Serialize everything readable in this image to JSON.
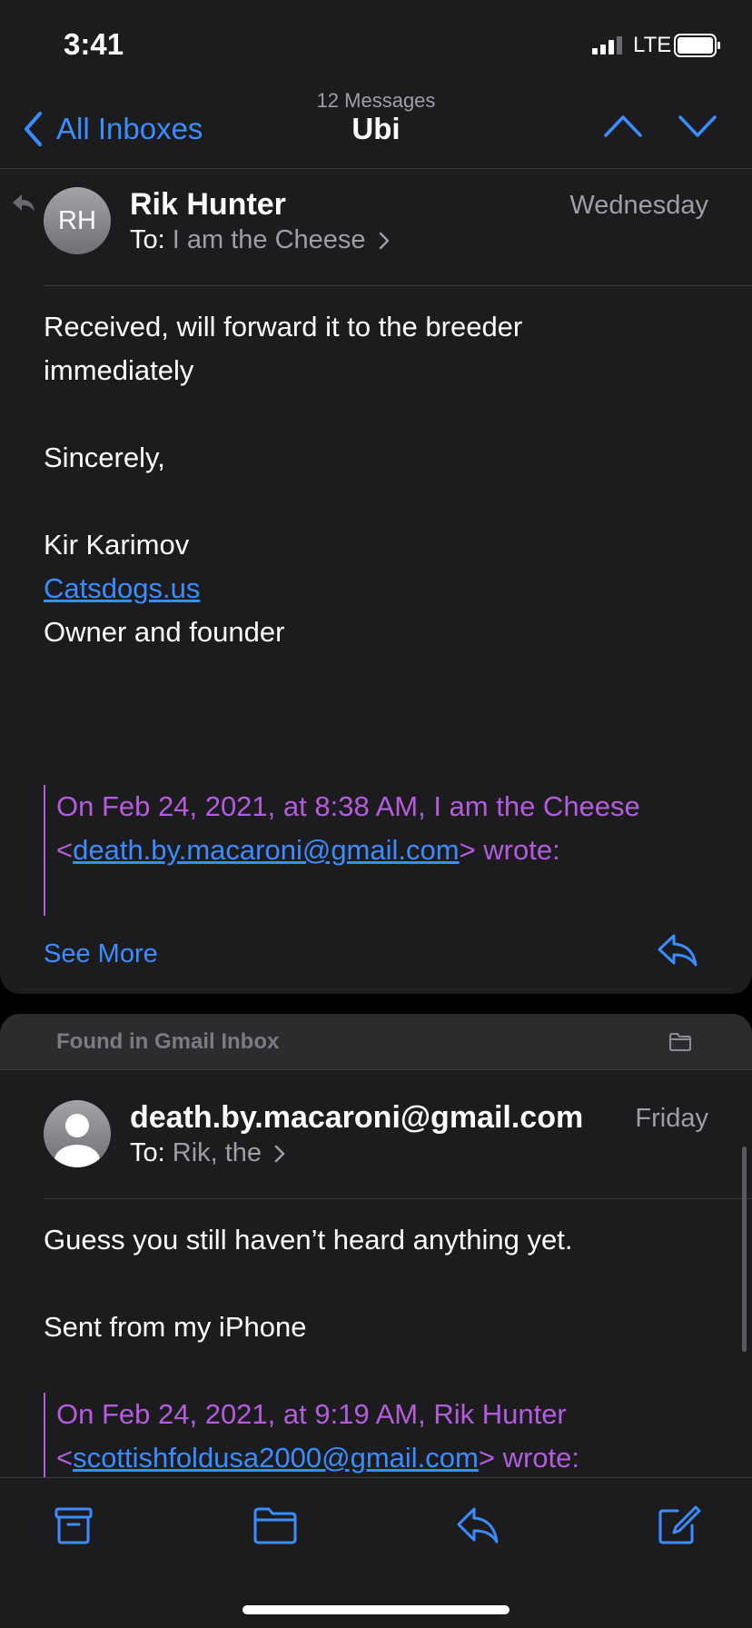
{
  "status_bar": {
    "time": "3:41",
    "network": "LTE"
  },
  "nav": {
    "back_label": "All Inboxes",
    "message_count": "12 Messages",
    "title": "Ubi"
  },
  "message1": {
    "avatar_initials": "RH",
    "sender": "Rik Hunter",
    "date": "Wednesday",
    "to_prefix": "To:",
    "to_recipient": "I am the Cheese",
    "body_line1": "Received, will forward it to the breeder",
    "body_line2": "immediately",
    "signoff": "Sincerely,",
    "signature_name": "Kir Karimov",
    "signature_link": "Catsdogs.us",
    "signature_title": "Owner and founder",
    "quote_line1": "On Feb 24, 2021, at 8:38 AM, I am the Cheese",
    "quote_lt": "<",
    "quote_email": "death.by.macaroni@gmail.com",
    "quote_suffix": "> wrote:",
    "see_more": "See More"
  },
  "found_in": {
    "label": "Found in Gmail Inbox"
  },
  "message2": {
    "sender": "death.by.macaroni@gmail.com",
    "date": "Friday",
    "to_prefix": "To:",
    "to_recipient": "Rik, the",
    "body_line1": "Guess you still haven’t heard anything yet.",
    "body_line2": "Sent from my iPhone",
    "quote_line1": "On Feb 24, 2021, at 9:19 AM, Rik Hunter",
    "quote_lt": "<",
    "quote_email": "scottishfoldusa2000@gmail.com",
    "quote_suffix": "> wrote:"
  },
  "colors": {
    "accent": "#3a8dfe",
    "quote": "#b45cdd",
    "background": "#1c1c1e",
    "secondary_text": "#9e9ea3"
  },
  "icons": {
    "toolbar": [
      "archive-icon",
      "folder-icon",
      "reply-icon",
      "compose-icon"
    ]
  }
}
